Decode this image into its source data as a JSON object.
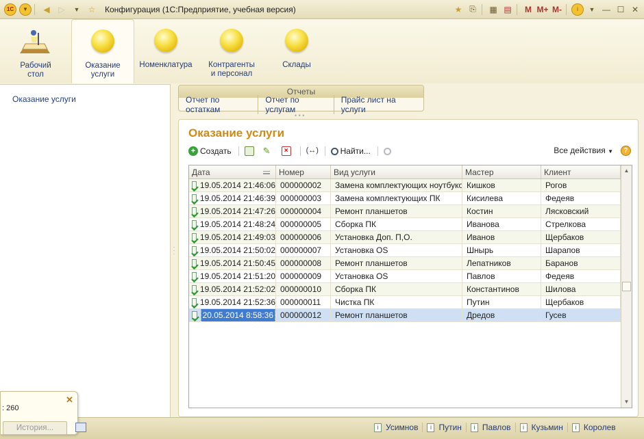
{
  "title": "Конфигурация  (1С:Предприятие, учебная версия)",
  "logo_text": "1С",
  "titlebar_m": [
    "M",
    "M+",
    "M-"
  ],
  "sections": [
    {
      "label_1": "Рабочий",
      "label_2": "стол",
      "icon": "desktop-icon",
      "active": false
    },
    {
      "label_1": "Оказание",
      "label_2": "услуги",
      "icon": "orb-icon",
      "active": true
    },
    {
      "label_1": "Номенклатура",
      "label_2": "",
      "icon": "orb-icon",
      "active": false
    },
    {
      "label_1": "Контрагенты",
      "label_2": "и персонал",
      "icon": "orb-icon",
      "active": false
    },
    {
      "label_1": "Склады",
      "label_2": "",
      "icon": "orb-icon",
      "active": false
    }
  ],
  "sidebar": {
    "items": [
      "Оказание услуги"
    ]
  },
  "reports": {
    "header": "Отчеты",
    "links": [
      "Отчет по остаткам",
      "Отчет по услугам",
      "Прайс лист на услуги"
    ]
  },
  "panel": {
    "title": "Оказание услуги",
    "create_label": "Создать",
    "find_label": "Найти...",
    "all_actions_label": "Все действия",
    "help_label": "?"
  },
  "table": {
    "columns": [
      "Дата",
      "Номер",
      "Вид услуги",
      "Мастер",
      "Клиент"
    ],
    "rows": [
      [
        "19.05.2014 21:46:06",
        "000000002",
        "Замена комплектующих ноутбуков",
        "Кишков",
        "Рогов"
      ],
      [
        "19.05.2014 21:46:39",
        "000000003",
        "Замена комплектующих ПК",
        "Кисилева",
        "Федеяв"
      ],
      [
        "19.05.2014 21:47:26",
        "000000004",
        "Ремонт планшетов",
        "Костин",
        "Лясковский"
      ],
      [
        "19.05.2014 21:48:24",
        "000000005",
        "Сборка ПК",
        "Иванова",
        "Стрелкова"
      ],
      [
        "19.05.2014 21:49:03",
        "000000006",
        "Установка Доп. П,О.",
        "Иванов",
        "Щербаков"
      ],
      [
        "19.05.2014 21:50:02",
        "000000007",
        "Установка OS",
        "Шнырь",
        "Шарапов"
      ],
      [
        "19.05.2014 21:50:45",
        "000000008",
        "Ремонт планшетов",
        "Лепатников",
        "Баранов"
      ],
      [
        "19.05.2014 21:51:20",
        "000000009",
        "Установка OS",
        "Павлов",
        "Федеяв"
      ],
      [
        "19.05.2014 21:52:02",
        "000000010",
        "Сборка ПК",
        "Константинов",
        "Шилова"
      ],
      [
        "19.05.2014 21:52:36",
        "000000011",
        "Чистка ПК",
        "Путин",
        "Щербаков"
      ],
      [
        "20.05.2014 8:58:36",
        "000000012",
        "Ремонт планшетов",
        "Дредов",
        "Гусев"
      ]
    ],
    "selected_row": 10
  },
  "popup": {
    "text": ": 260"
  },
  "status": {
    "history_label": "История...",
    "users": [
      "Усимнов",
      "Путин",
      "Павлов",
      "Кузьмин",
      "Королев"
    ]
  },
  "colors": {
    "accent": "#d38a10",
    "link": "#223c7a",
    "selection": "#cfe0f5"
  }
}
